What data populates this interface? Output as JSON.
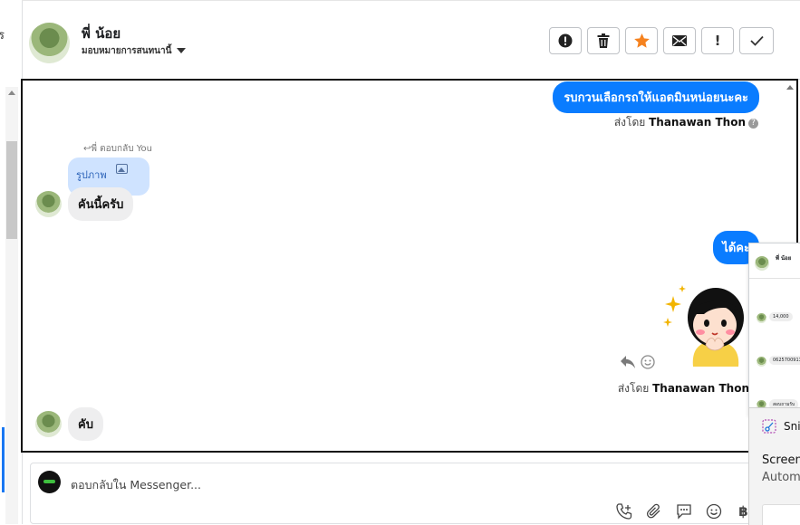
{
  "sidebar": {
    "clip_char": "ร"
  },
  "header": {
    "contact_name": "พี่ น้อย",
    "assign_label": "มอบหมายการสนทนานี้"
  },
  "toolbar": {
    "spam_label": "!",
    "done_icon": "check-icon",
    "colors": {
      "star": "#f5821f"
    }
  },
  "messages": {
    "out1": "รบกวนเลือกรถให้แอดมินหน่อยนะคะ",
    "sent_by_prefix": "ส่งโดย",
    "sent_by_name": "Thanawan Thon",
    "reply_note": "พี่ ตอบกลับ You",
    "reply_card_label": "รูปภาพ",
    "in1": "คันนี้ครับ",
    "out2": "ได้คะ",
    "in2": "คับ"
  },
  "composer": {
    "placeholder": "ตอบกลับใน Messenger..."
  },
  "mini_chat": {
    "name": "พี่ น้อย",
    "msg1": "14,000",
    "msg2": "0625700913",
    "msg3": "สอบถามรับ"
  },
  "snip": {
    "title": "Snipping Tool",
    "line1": "Screenshot copied to clipboard",
    "line2": "Automatically saved to screenshots folder"
  },
  "colors": {
    "accent": "#0a7cff",
    "reply_card": "#cfe3ff",
    "incoming": "#eeeeef"
  }
}
